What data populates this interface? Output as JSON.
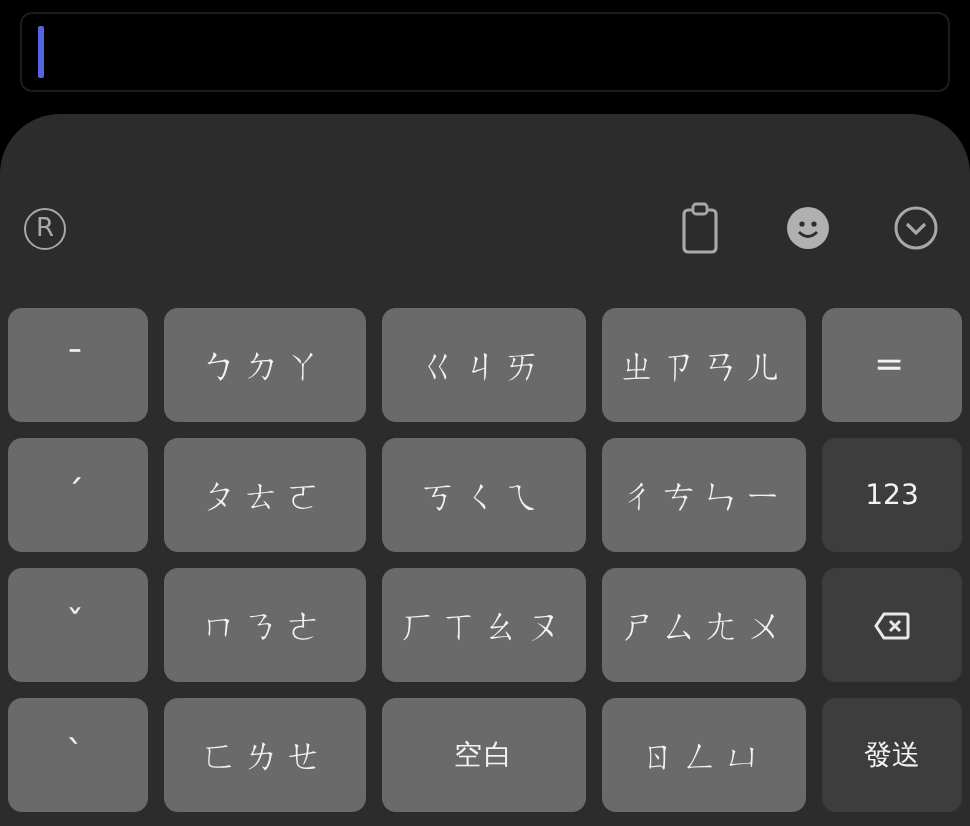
{
  "text_field": {
    "focused": true
  },
  "toolbar": {
    "mode_label": "R"
  },
  "rows": [
    [
      {
        "label": "ˉ",
        "kind": "key"
      },
      {
        "label": "ㄅㄉㄚ",
        "kind": "key"
      },
      {
        "label": "ㄍㄐㄞ",
        "kind": "key"
      },
      {
        "label": "ㄓㄗㄢㄦ",
        "kind": "key"
      },
      {
        "label": "=",
        "kind": "key"
      }
    ],
    [
      {
        "label": "ˊ",
        "kind": "key"
      },
      {
        "label": "ㄆㄊㄛ",
        "kind": "key"
      },
      {
        "label": "ㄎㄑㄟ",
        "kind": "key"
      },
      {
        "label": "ㄔㄘㄣㄧ",
        "kind": "key"
      },
      {
        "label": "123",
        "kind": "function"
      }
    ],
    [
      {
        "label": "ˇ",
        "kind": "key"
      },
      {
        "label": "ㄇㄋㄜ",
        "kind": "key"
      },
      {
        "label": "ㄏㄒㄠㄡ",
        "kind": "key"
      },
      {
        "label": "ㄕㄙㄤㄨ",
        "kind": "key"
      },
      {
        "kind": "backspace"
      }
    ],
    [
      {
        "label": "ˋ",
        "kind": "key"
      },
      {
        "label": "ㄈㄌㄝ",
        "kind": "key"
      },
      {
        "label": "空白",
        "kind": "space"
      },
      {
        "label": "ㄖㄥㄩ",
        "kind": "key"
      },
      {
        "label": "發送",
        "kind": "function"
      }
    ]
  ]
}
